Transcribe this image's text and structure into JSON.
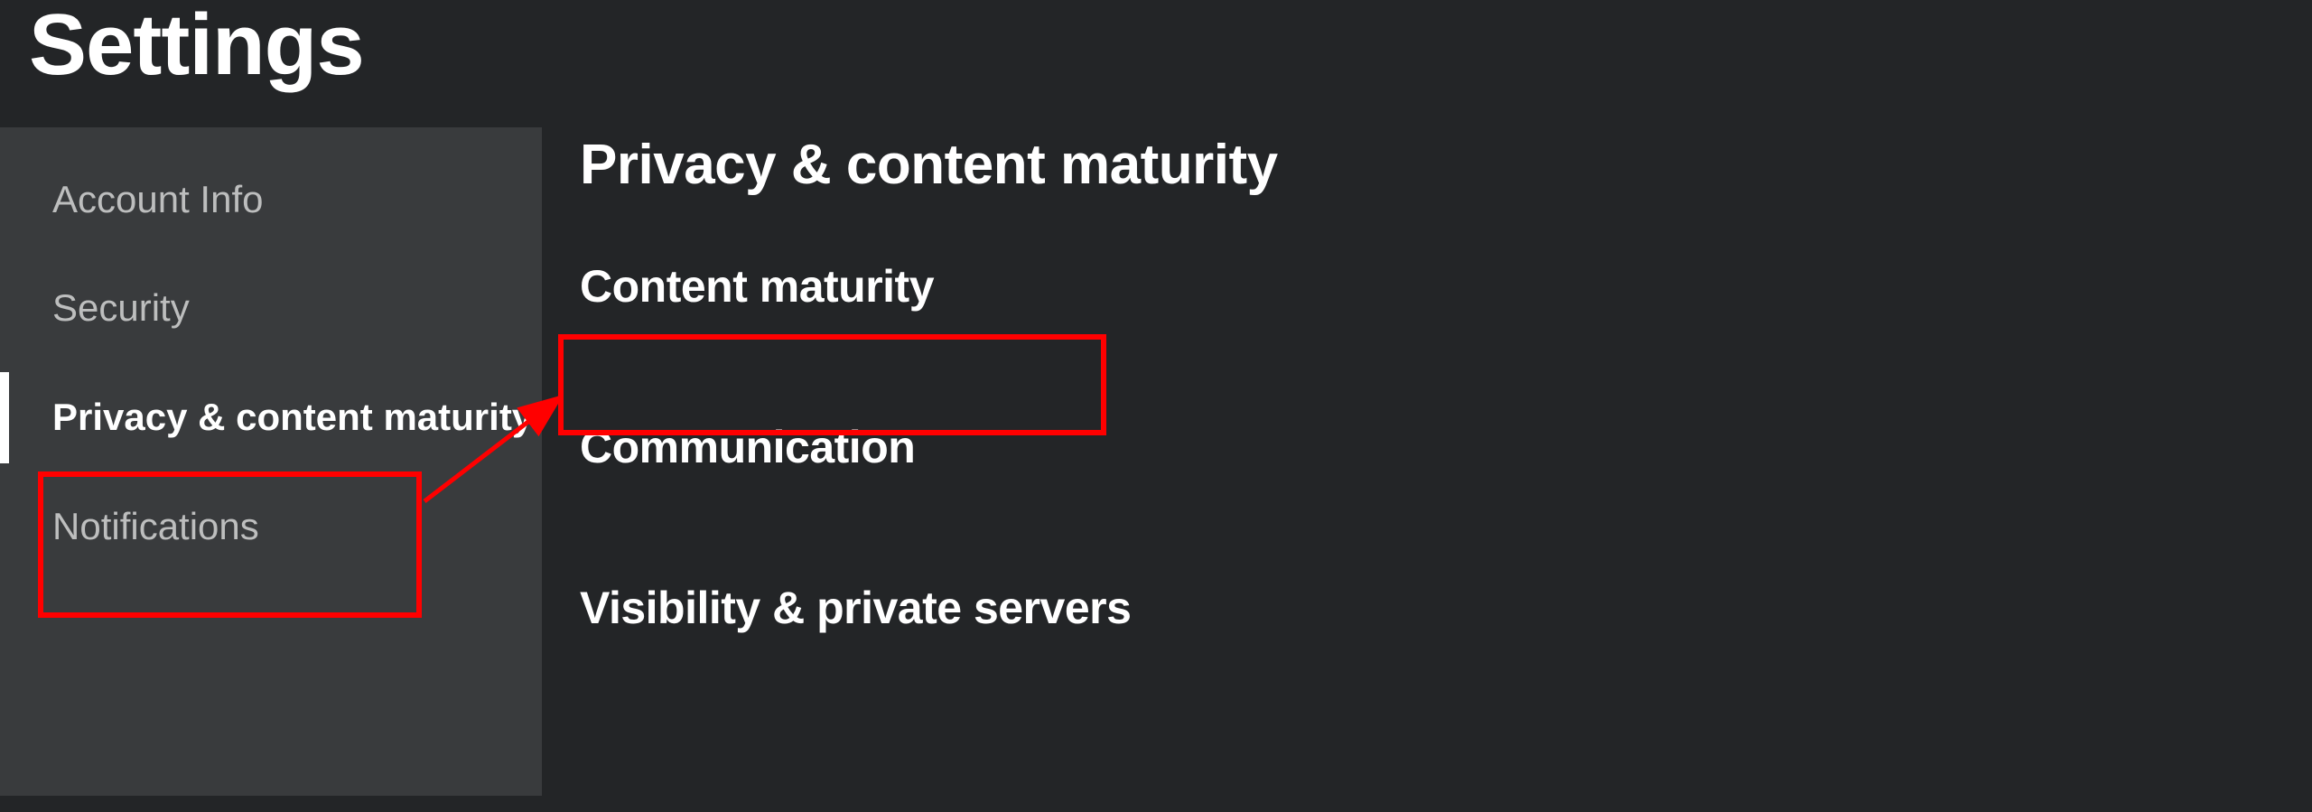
{
  "page": {
    "title": "Settings"
  },
  "sidebar": {
    "items": [
      {
        "label": "Account Info",
        "active": false
      },
      {
        "label": "Security",
        "active": false
      },
      {
        "label": "Privacy & content maturity",
        "active": true
      },
      {
        "label": "Notifications",
        "active": false
      }
    ]
  },
  "main": {
    "title": "Privacy & content maturity",
    "sections": [
      {
        "label": "Content maturity"
      },
      {
        "label": "Communication"
      },
      {
        "label": "Visibility & private servers"
      }
    ]
  },
  "annotations": {
    "highlight_color": "#ff0000"
  }
}
